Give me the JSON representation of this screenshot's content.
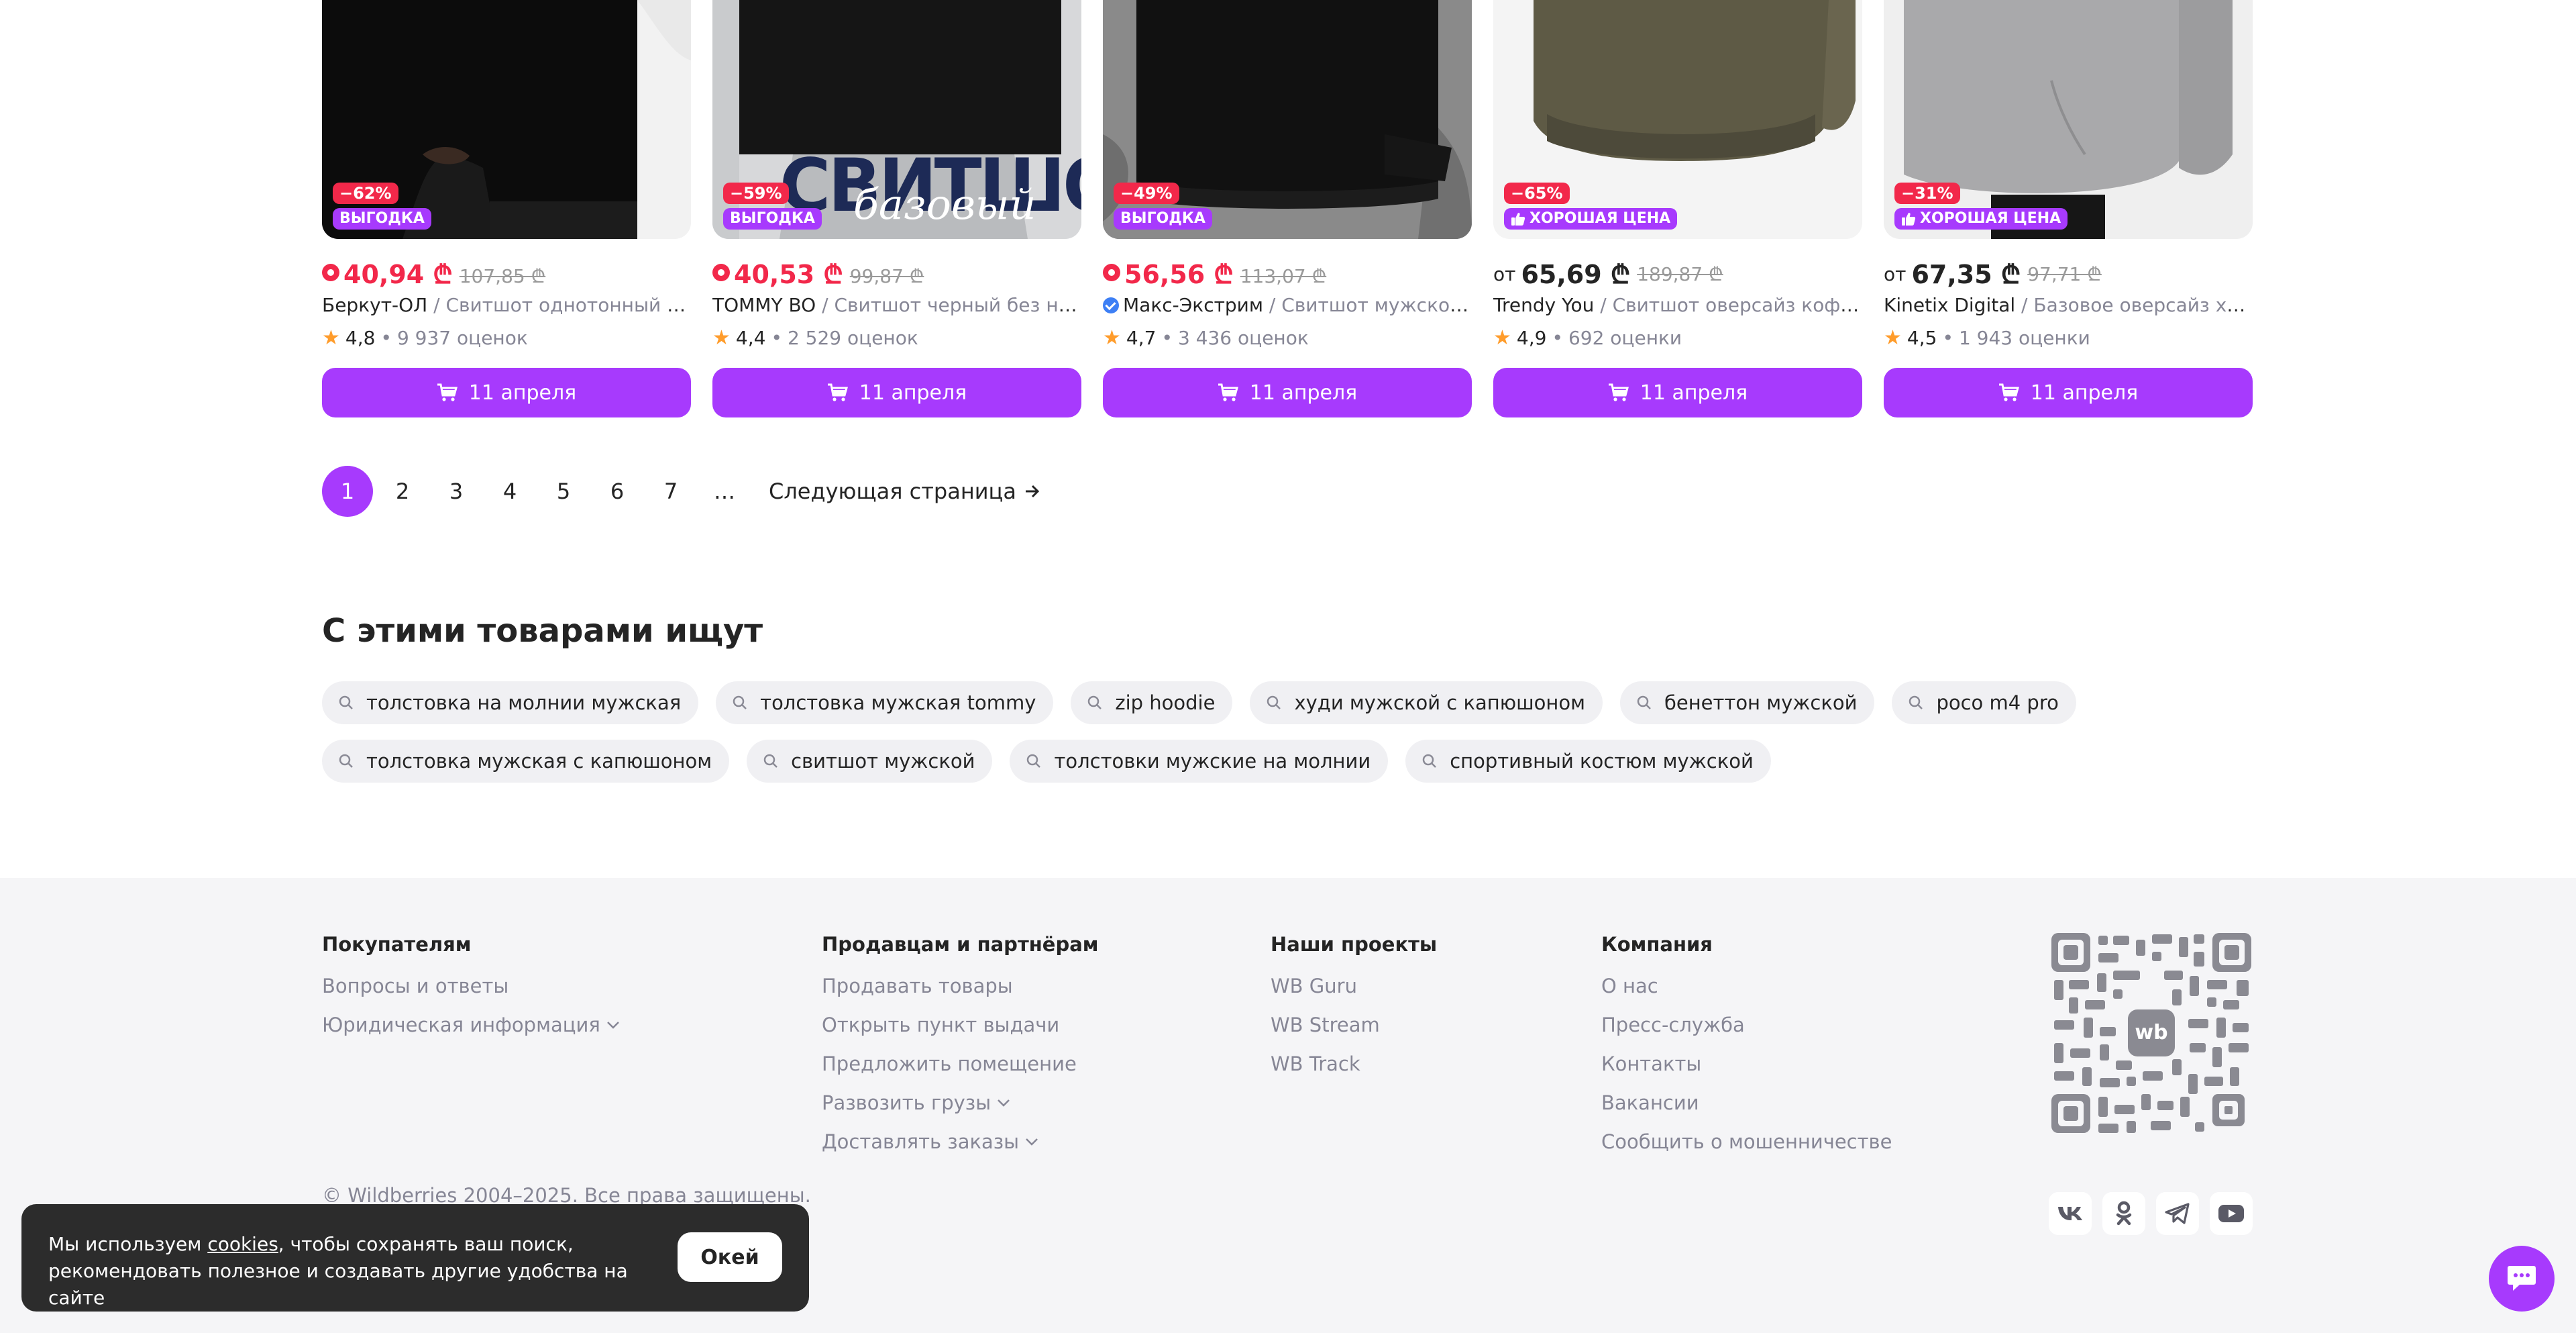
{
  "colors": {
    "accent": "#a73afd",
    "discount": "#f2284a",
    "muted_text": "#868695",
    "footer_bg": "#f5f5f7"
  },
  "products": [
    {
      "discount": "−62%",
      "label": "ВЫГОДКА",
      "label_icon": "",
      "price_prefix": "",
      "price": "40,94 ₾",
      "old_price": "107,85 ₾",
      "price_style": "wallet",
      "brand": "Беркут-ОЛ",
      "verified": false,
      "name": "Свитшот однотонный без начеса",
      "rating": "4,8",
      "reviews": "9 937 оценок",
      "delivery": "11 апреля"
    },
    {
      "discount": "−59%",
      "label": "ВЫГОДКА",
      "label_icon": "",
      "price_prefix": "",
      "price": "40,53 ₾",
      "old_price": "99,87 ₾",
      "price_style": "wallet",
      "brand": "TOMMY BO",
      "verified": false,
      "name": "Свитшот черный без начеса",
      "rating": "4,4",
      "reviews": "2 529 оценок",
      "delivery": "11 апреля",
      "image_text": "СВИТШОТ",
      "image_text2": "базовый"
    },
    {
      "discount": "−49%",
      "label": "ВЫГОДКА",
      "label_icon": "",
      "price_prefix": "",
      "price": "56,56 ₾",
      "old_price": "113,07 ₾",
      "price_style": "wallet",
      "brand": "Макс-Экстрим",
      "verified": true,
      "name": "Свитшот мужской без начеса",
      "rating": "4,7",
      "reviews": "3 436 оценок",
      "delivery": "11 апреля"
    },
    {
      "discount": "−65%",
      "label": "ХОРОШАЯ ЦЕНА",
      "label_icon": "thumbs-up-icon",
      "price_prefix": "от",
      "price": "65,69 ₾",
      "old_price": "189,87 ₾",
      "price_style": "plain",
      "brand": "Trendy You",
      "verified": false,
      "name": "Свитшот оверсайз кофта с начесом",
      "rating": "4,9",
      "reviews": "692 оценки",
      "delivery": "11 апреля"
    },
    {
      "discount": "−31%",
      "label": "ХОРОШАЯ ЦЕНА",
      "label_icon": "thumbs-up-icon",
      "price_prefix": "от",
      "price": "67,35 ₾",
      "old_price": "97,71 ₾",
      "price_style": "plain",
      "brand": "Kinetix Digital",
      "verified": false,
      "name": "Базовое оверсайз худи с начесом",
      "rating": "4,5",
      "reviews": "1 943 оценки",
      "delivery": "11 апреля"
    }
  ],
  "pagination": {
    "pages": [
      "1",
      "2",
      "3",
      "4",
      "5",
      "6",
      "7",
      "…"
    ],
    "current": "1",
    "next_label": "Следующая страница"
  },
  "related": {
    "title": "С этими товарами ищут",
    "row1": [
      "толстовка на молнии мужская",
      "толстовка мужская tommy",
      "zip hoodie",
      "худи мужской с капюшоном",
      "бенеттон мужской",
      "poco m4 pro"
    ],
    "row2": [
      "толстовка мужская с капюшоном",
      "свитшот мужской",
      "толстовки мужские на молнии",
      "спортивный костюм мужской"
    ]
  },
  "footer": {
    "columns": [
      {
        "title": "Покупателям",
        "links": [
          {
            "label": "Вопросы и ответы",
            "dropdown": false
          },
          {
            "label": "Юридическая информация",
            "dropdown": true
          }
        ]
      },
      {
        "title": "Продавцам и партнёрам",
        "links": [
          {
            "label": "Продавать товары",
            "dropdown": false
          },
          {
            "label": "Открыть пункт выдачи",
            "dropdown": false
          },
          {
            "label": "Предложить помещение",
            "dropdown": false
          },
          {
            "label": "Развозить грузы",
            "dropdown": true
          },
          {
            "label": "Доставлять заказы",
            "dropdown": true
          }
        ]
      },
      {
        "title": "Наши проекты",
        "links": [
          {
            "label": "WB Guru",
            "dropdown": false
          },
          {
            "label": "WB Stream",
            "dropdown": false
          },
          {
            "label": "WB Track",
            "dropdown": false
          }
        ]
      },
      {
        "title": "Компания",
        "links": [
          {
            "label": "О нас",
            "dropdown": false
          },
          {
            "label": "Пресс-служба",
            "dropdown": false
          },
          {
            "label": "Контакты",
            "dropdown": false
          },
          {
            "label": "Вакансии",
            "dropdown": false
          },
          {
            "label": "Сообщить о мошенничестве",
            "dropdown": false
          }
        ]
      }
    ],
    "qr_logo_text": "wb",
    "copyright": "© Wildberries 2004–2025. Все права защищены.",
    "socials": [
      "vk-icon",
      "odnoklassniki-icon",
      "telegram-icon",
      "youtube-icon"
    ]
  },
  "cookie": {
    "text_before": "Мы используем ",
    "link": "cookies",
    "text_after": ", чтобы сохранять ваш поиск, рекомендовать полезное и создавать другие удобства на сайте",
    "button": "Окей"
  },
  "chat": {
    "icon": "chat-icon"
  }
}
